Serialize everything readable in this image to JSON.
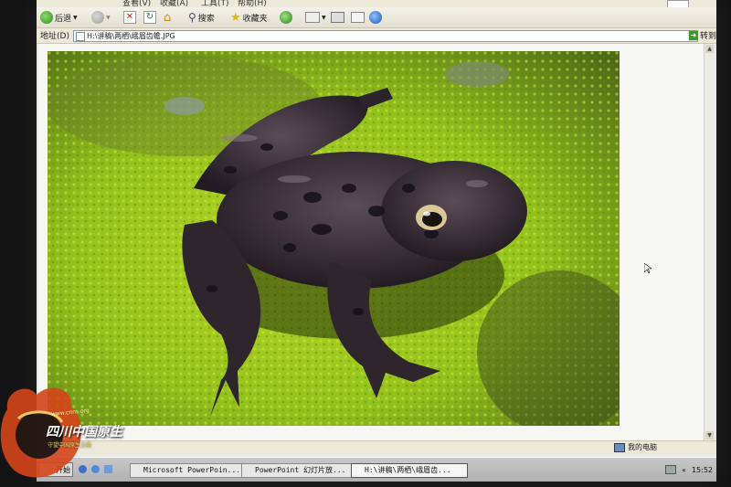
{
  "menubar": {
    "items": [
      "查看(V)",
      "收藏(A)",
      "工具(T)",
      "帮助(H)"
    ]
  },
  "toolbar": {
    "back_label": "后退",
    "search_label": "搜索",
    "favorites_label": "收藏夹"
  },
  "address": {
    "label": "地址(D)",
    "value": "H:\\讲稿\\两栖\\峨眉齿蟾.JPG",
    "go_label": "转到"
  },
  "statusbar": {
    "zone": "我的电脑"
  },
  "taskbar": {
    "start_label": "开始",
    "tasks": [
      {
        "label": "Microsoft PowerPoin..."
      },
      {
        "label": "PowerPoint 幻灯片放..."
      },
      {
        "label": "H:\\讲稿\\两栖\\峨眉齿..."
      }
    ],
    "clock": "15:52",
    "tray_chevron": "«"
  },
  "watermark": {
    "title": "四川中国原生",
    "subtitle": "守望中国原生之美",
    "url": "www.cnns.org"
  },
  "colors": {
    "moss": "#9bc21d",
    "frog": "#3a3038",
    "logo": "#d4451a"
  },
  "icons": [
    "back-icon",
    "forward-icon",
    "stop-icon",
    "refresh-icon",
    "home-icon",
    "search-icon",
    "favorites-icon",
    "media-icon",
    "mail-icon",
    "print-icon",
    "edit-icon",
    "messenger-icon",
    "go-icon",
    "file-icon",
    "computer-icon",
    "network-icon",
    "windows-logo-icon",
    "cursor-icon"
  ]
}
